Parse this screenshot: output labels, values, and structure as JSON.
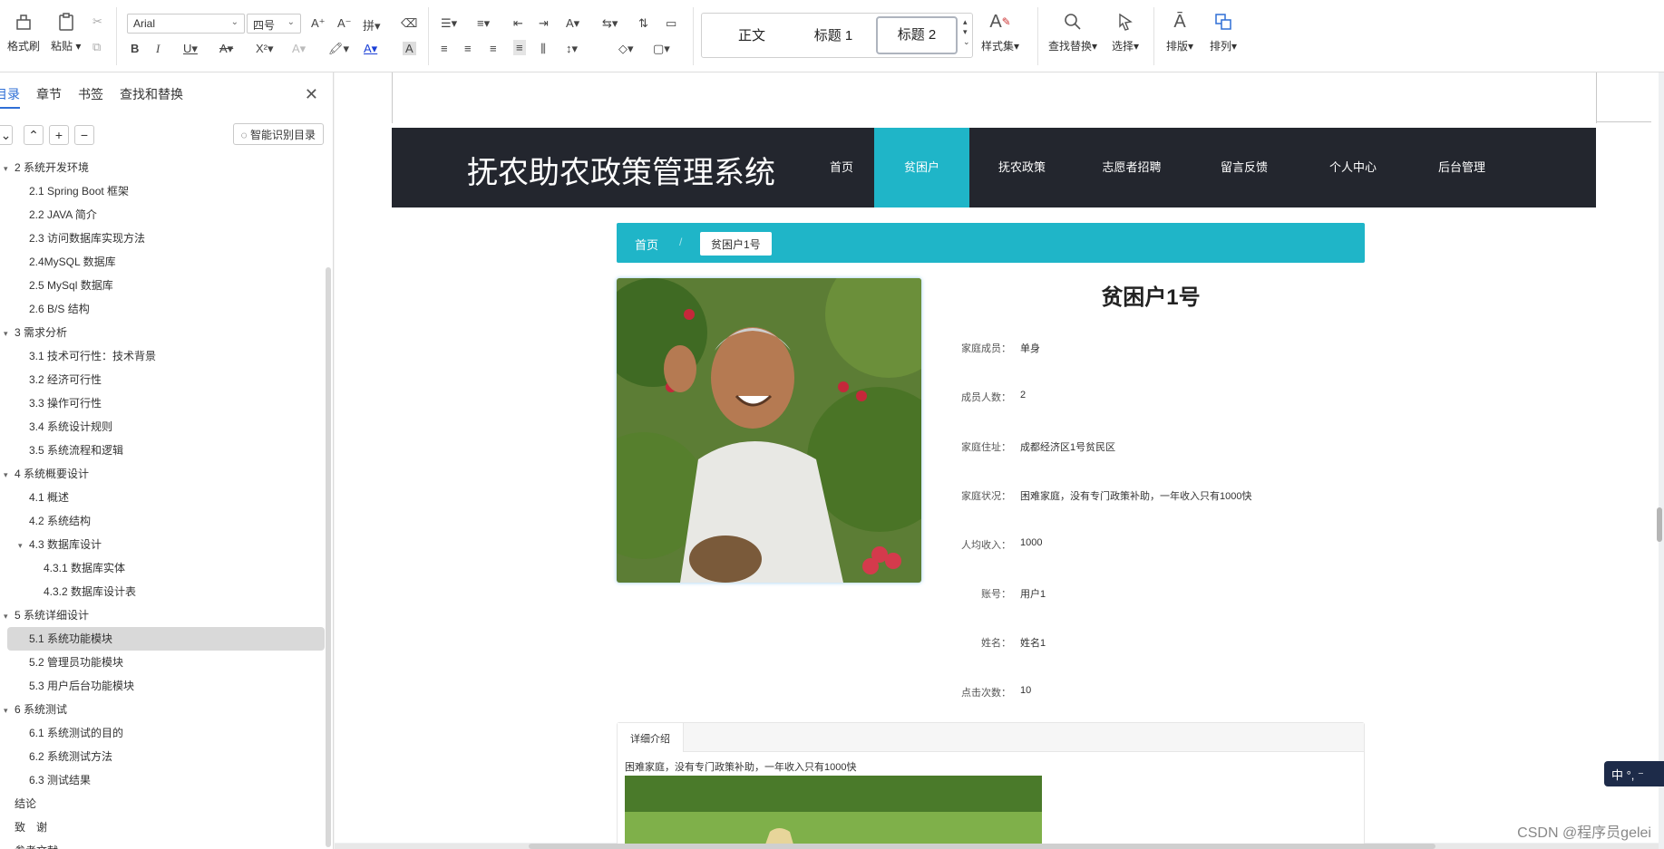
{
  "ribbon": {
    "format_painter": "格式刷",
    "paste": "粘贴",
    "font_name": "Arial",
    "font_size": "四号",
    "styles": [
      "正文",
      "标题 1",
      "标题 2"
    ],
    "style_set": "样式集",
    "find_replace": "查找替换",
    "select": "选择",
    "layout": "排版",
    "arrange": "排列"
  },
  "sidebar": {
    "tabs": [
      "目录",
      "章节",
      "书签",
      "查找和替换"
    ],
    "smart_toc": "智能识别目录",
    "toc": [
      {
        "label": "2 系统开发环境",
        "level": 0,
        "toggle": "▾"
      },
      {
        "label": "2.1 Spring Boot 框架",
        "level": 1
      },
      {
        "label": "2.2 JAVA 简介",
        "level": 1
      },
      {
        "label": "2.3 访问数据库实现方法",
        "level": 1
      },
      {
        "label": "2.4MySQL 数据库",
        "level": 1
      },
      {
        "label": "2.5 MySql 数据库",
        "level": 1
      },
      {
        "label": "2.6 B/S 结构",
        "level": 1
      },
      {
        "label": "3 需求分析",
        "level": 0,
        "toggle": "▾"
      },
      {
        "label": "3.1 技术可行性：技术背景",
        "level": 1
      },
      {
        "label": "3.2 经济可行性",
        "level": 1
      },
      {
        "label": "3.3 操作可行性",
        "level": 1
      },
      {
        "label": "3.4 系统设计规则",
        "level": 1
      },
      {
        "label": "3.5 系统流程和逻辑",
        "level": 1
      },
      {
        "label": "4 系统概要设计",
        "level": 0,
        "toggle": "▾"
      },
      {
        "label": "4.1 概述",
        "level": 1
      },
      {
        "label": "4.2 系统结构",
        "level": 1
      },
      {
        "label": "4.3 数据库设计",
        "level": 1,
        "toggle": "▾"
      },
      {
        "label": "4.3.1  数据库实体",
        "level": 2
      },
      {
        "label": "4.3.2  数据库设计表",
        "level": 2
      },
      {
        "label": "5 系统详细设计",
        "level": 0,
        "toggle": "▾"
      },
      {
        "label": "5.1 系统功能模块",
        "level": 1,
        "selected": true
      },
      {
        "label": "5.2 管理员功能模块",
        "level": 1
      },
      {
        "label": "5.3 用户后台功能模块",
        "level": 1
      },
      {
        "label": "6 系统测试",
        "level": 0,
        "toggle": "▾"
      },
      {
        "label": "6.1 系统测试的目的",
        "level": 1
      },
      {
        "label": "6.2 系统测试方法",
        "level": 1
      },
      {
        "label": "6.3  测试结果",
        "level": 1
      },
      {
        "label": "结论",
        "level": 0
      },
      {
        "label": "致　谢",
        "level": 0
      },
      {
        "label": "参考文献",
        "level": 0
      }
    ]
  },
  "site": {
    "title": "抚农助农政策管理系统",
    "nav": [
      "首页",
      "贫困户",
      "抚农政策",
      "志愿者招聘",
      "留言反馈",
      "个人中心",
      "后台管理"
    ],
    "breadcrumb_home": "首页",
    "breadcrumb_sep": "/",
    "breadcrumb_current": "贫困户1号",
    "detail_title": "贫困户1号",
    "fields": [
      {
        "label": "家庭成员：",
        "value": "单身"
      },
      {
        "label": "成员人数：",
        "value": "2"
      },
      {
        "label": "家庭住址：",
        "value": "成都经济区1号贫民区"
      },
      {
        "label": "家庭状况：",
        "value": "困难家庭，没有专门政策补助，一年收入只有1000快"
      },
      {
        "label": "人均收入：",
        "value": "1000"
      },
      {
        "label": "账号：",
        "value": "用户1"
      },
      {
        "label": "姓名：",
        "value": "姓名1"
      },
      {
        "label": "点击次数：",
        "value": "10"
      }
    ],
    "detail_tab": "详细介绍",
    "detail_text": "困难家庭，没有专门政策补助，一年收入只有1000快"
  },
  "watermark": "CSDN @程序员gelei",
  "ime": "中 °, ⁻",
  "colors": {
    "nav_bg": "#23262e",
    "accent": "#1fb5c8",
    "link_blue": "#2f6fd6"
  }
}
